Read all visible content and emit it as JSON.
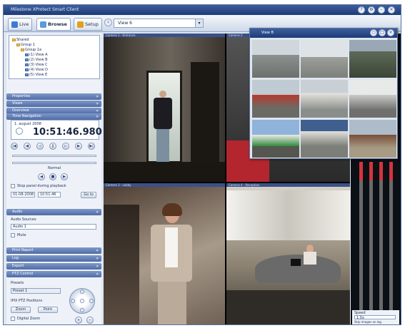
{
  "window": {
    "title": "Milestone XProtect Smart Client"
  },
  "tabs": [
    {
      "label": "Live"
    },
    {
      "label": "Browse"
    },
    {
      "label": "Setup"
    }
  ],
  "view_selector": {
    "value": "View 6"
  },
  "camera_tree": [
    {
      "label": "Shared",
      "kind": "folder"
    },
    {
      "label": "Group 1",
      "kind": "folder"
    },
    {
      "label": "Group 1a",
      "kind": "folder"
    },
    {
      "label": "(1) View A",
      "kind": "view"
    },
    {
      "label": "(2) View B",
      "kind": "view"
    },
    {
      "label": "(3) View C",
      "kind": "view"
    },
    {
      "label": "(4) View D",
      "kind": "view"
    },
    {
      "label": "(5) View E",
      "kind": "view"
    }
  ],
  "sections": {
    "s1": "Properties",
    "s2": "Views",
    "s3": "Overview",
    "s4": "Time Navigation",
    "s5": "Audio",
    "s6": "Print Report",
    "s7": "Log",
    "s8": "Export",
    "s9": "PTZ Control"
  },
  "time": {
    "date": "1. august 2008",
    "clock": "10:51:46.980",
    "label_normal": "Normal",
    "stop_label": "Stop panel during playback",
    "from_date": "01-08-2008",
    "from_time": "10:51:46",
    "go_label": "Go to"
  },
  "audio": {
    "label": "Audio Sources",
    "value": "Audio 1",
    "mute_label": "Mute"
  },
  "ptz": {
    "presets_label": "Presets",
    "preset_value": "Preset 1",
    "ptz_label": "IPIX PTZ Positions",
    "btn1": "Zoom",
    "btn2": "Point",
    "digital_zoom": "Digital Zoom"
  },
  "cameras": {
    "c1": "Camera 1 - Entrance",
    "c2": "Camera 2",
    "c3": "Camera 3 - Lobby",
    "c4": "Camera 4 - Reception"
  },
  "popup": {
    "title": "View B"
  },
  "side": {
    "speed_label": "Speed",
    "speed_value": "1.0x",
    "images_label": "Skip images on lag"
  },
  "colors": {
    "title_bar": "#1c3a78",
    "section_header": "#4f6ca6",
    "vu_peak": "#d5343e"
  }
}
